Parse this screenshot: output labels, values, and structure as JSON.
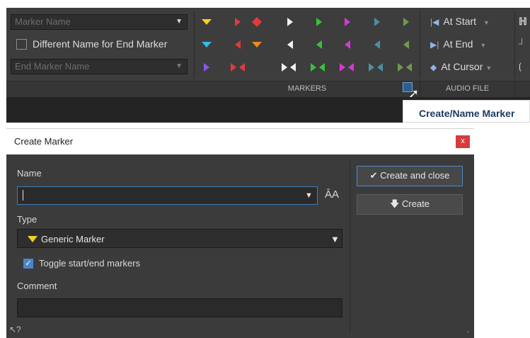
{
  "ribbon": {
    "marker_name_placeholder": "Marker Name",
    "different_name_label": "Different Name for End Marker",
    "end_marker_name_placeholder": "End Marker Name",
    "groups": {
      "markers": "MARKERS",
      "audio_file": "AUDIO FILE"
    },
    "audio_file_buttons": [
      {
        "label": "At Start",
        "icon": "skip-to-start-icon"
      },
      {
        "label": "At End",
        "icon": "skip-to-end-icon"
      },
      {
        "label": "At Cursor",
        "icon": "cursor-icon"
      }
    ],
    "tooltip": "Create/Name Marker",
    "colors": {
      "yellow": "#f2d21b",
      "cyan": "#39b9e6",
      "red": "#e23a3a",
      "orange": "#f08a1a",
      "white": "#f0f0f0",
      "green": "#35c23a",
      "magenta": "#d13ad6",
      "blue": "#5b6cf0",
      "muted_cyan": "#4b8fa3",
      "muted_green": "#6f9a4c",
      "purple": "#8a55f0"
    }
  },
  "dialog": {
    "title": "Create Marker",
    "close_label": "x",
    "name_label": "Name",
    "name_value": "",
    "type_label": "Type",
    "type_value": "Generic Marker",
    "toggle_label": "Toggle start/end markers",
    "toggle_checked": true,
    "comment_label": "Comment",
    "comment_value": "",
    "create_close_label": "Create and close",
    "create_label": "Create",
    "accent": "#4a86c7"
  }
}
